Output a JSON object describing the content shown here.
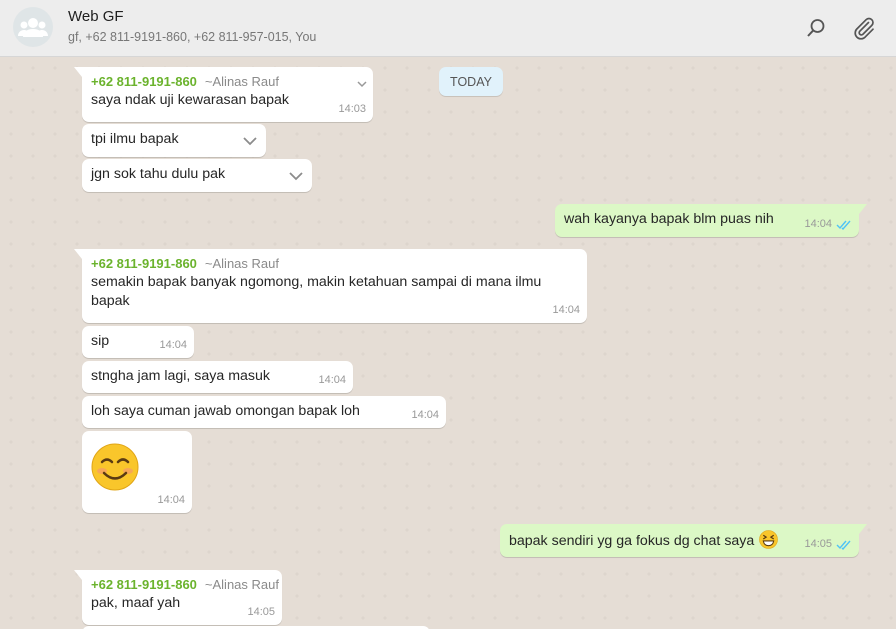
{
  "header": {
    "title": "Web GF",
    "participants": "gf, +62 811-9191-860, +62 811-957-015, You"
  },
  "chat": {
    "date_divider": "TODAY",
    "messages": [
      {
        "sender_number": "+62 811-9191-860",
        "sender_name": "~Alinas Rauf",
        "text": "saya ndak uji kewarasan bapak",
        "time": "14:03"
      },
      {
        "text": "tpi ilmu bapak"
      },
      {
        "text": "jgn sok tahu dulu pak"
      },
      {
        "text": "wah kayanya bapak blm puas nih",
        "time": "14:04"
      },
      {
        "sender_number": "+62 811-9191-860",
        "sender_name": "~Alinas Rauf",
        "text": "semakin bapak banyak ngomong, makin ketahuan sampai di mana ilmu bapak",
        "time": "14:04"
      },
      {
        "text": "sip",
        "time": "14:04"
      },
      {
        "text": "stngha jam lagi, saya masuk",
        "time": "14:04"
      },
      {
        "text": "loh saya cuman jawab omongan bapak loh",
        "time": "14:04"
      },
      {
        "emoji": "smiling-face",
        "time": "14:04"
      },
      {
        "text": "bapak sendiri yg ga fokus dg chat saya",
        "time": "14:05"
      },
      {
        "sender_number": "+62 811-9191-860",
        "sender_name": "~Alinas Rauf",
        "text": "pak, maaf yah",
        "time": "14:05"
      }
    ]
  },
  "colors": {
    "incoming": "#ffffff",
    "outgoing": "#dcf8c6",
    "sender_number": "#6bb32d",
    "read_ticks": "#4fc3f7"
  }
}
